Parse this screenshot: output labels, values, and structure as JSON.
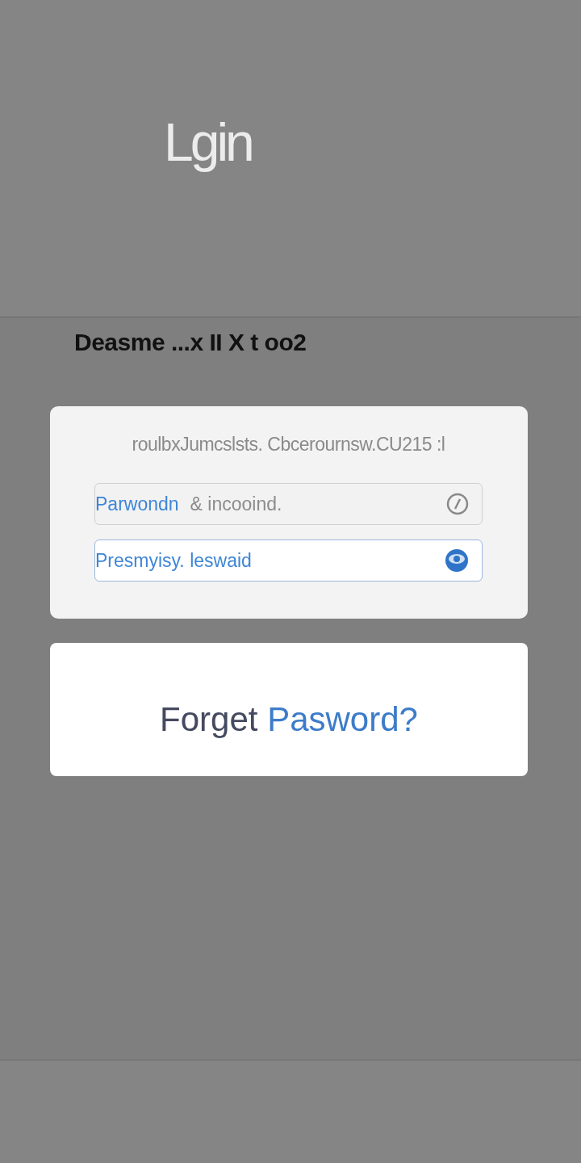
{
  "title": "Lgin",
  "subtitle": "Deasme ...x ІІ Х t oo2",
  "login_card": {
    "caption": "roulbxJumcslsts. Cbcerournsw.CU215 :l",
    "fields": [
      {
        "label": "Parwondn",
        "value": "& incooind.",
        "focused": false
      },
      {
        "value": "Presmyisy. leswaid",
        "focused": true
      }
    ]
  },
  "forgot": {
    "lead": "Forget",
    "link": "Pasword?"
  }
}
